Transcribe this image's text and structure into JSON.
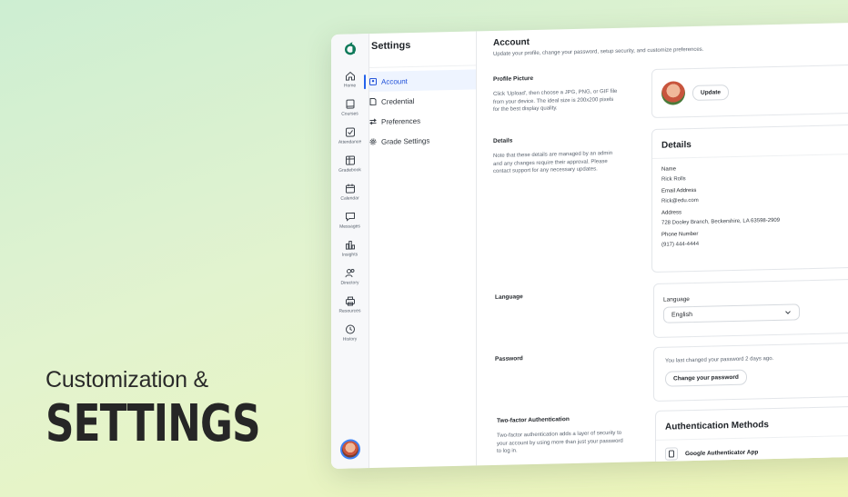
{
  "hero": {
    "subtitle": "Customization &",
    "title": "SETTINGS"
  },
  "rail": {
    "items": [
      {
        "label": "Home",
        "icon": "home-icon"
      },
      {
        "label": "Courses",
        "icon": "book-icon"
      },
      {
        "label": "Attendance",
        "icon": "checkbox-icon"
      },
      {
        "label": "Gradebook",
        "icon": "grid-icon"
      },
      {
        "label": "Calendar",
        "icon": "calendar-icon"
      },
      {
        "label": "Messages",
        "icon": "chat-icon"
      },
      {
        "label": "Insights",
        "icon": "chart-icon"
      },
      {
        "label": "Directory",
        "icon": "people-icon"
      },
      {
        "label": "Resources",
        "icon": "printer-icon"
      },
      {
        "label": "History",
        "icon": "clock-icon"
      }
    ]
  },
  "settings_nav": {
    "title": "Settings",
    "items": [
      {
        "label": "Account"
      },
      {
        "label": "Credential"
      },
      {
        "label": "Preferences"
      },
      {
        "label": "Grade Settings"
      }
    ]
  },
  "account": {
    "title": "Account",
    "description": "Update your profile, change your password, setup security, and customize preferences.",
    "profile_picture": {
      "label": "Profile Picture",
      "description": "Click 'Upload', then choose a JPG, PNG, or GIF file from your device. The ideal size is 200x200 pixels for the best display quality.",
      "button": "Update"
    },
    "details": {
      "label": "Details",
      "description": "Note that these details are managed by an admin and any changes require their approval. Please contact support for any necessary updates.",
      "card_title": "Details",
      "fields": [
        {
          "key": "Name",
          "value": "Rick Rolls"
        },
        {
          "key": "Email Address",
          "value": "Rick@edu.com"
        },
        {
          "key": "Address",
          "value": "728 Dooley Branch, Beckershire, LA 63598-2909"
        },
        {
          "key": "Phone Number",
          "value": "(917) 444-4444"
        }
      ]
    },
    "language": {
      "label": "Language",
      "field_label": "Language",
      "value": "English"
    },
    "password": {
      "label": "Password",
      "note": "You last changed your password 2 days ago.",
      "button": "Change your password"
    },
    "two_factor": {
      "label": "Two-factor Authentication",
      "description": "Two-factor authentication adds a layer of security to your account by using more than just your password to log in.",
      "card_title": "Authentication Methods",
      "method": "Google Authenticator App"
    }
  },
  "colors": {
    "accent": "#2563eb",
    "brand": "#0e7a5a"
  }
}
